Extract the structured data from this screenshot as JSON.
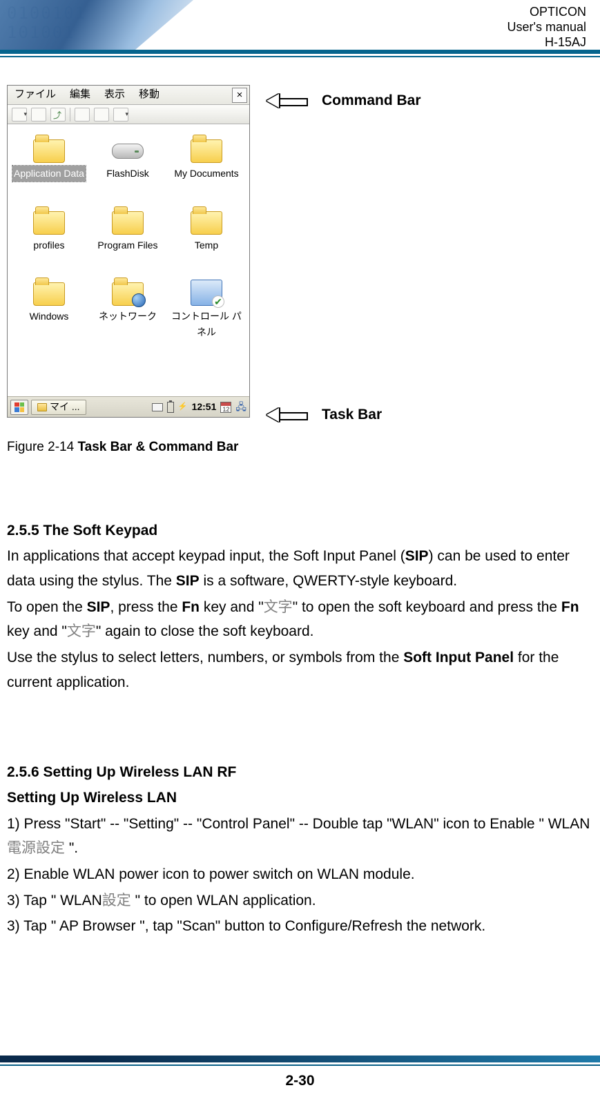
{
  "header": {
    "line1": "OPTICON",
    "line2": "User's manual",
    "line3": "H-15AJ"
  },
  "callouts": {
    "command_bar": "Command Bar",
    "task_bar": "Task Bar"
  },
  "menubar": {
    "file": "ファイル",
    "edit": "編集",
    "view": "表示",
    "go": "移動",
    "close": "×"
  },
  "icons": {
    "app_data": "Application Data",
    "flashdisk": "FlashDisk",
    "my_documents": "My Documents",
    "profiles": "profiles",
    "program_files": "Program Files",
    "temp": "Temp",
    "windows": "Windows",
    "network": "ネットワーク",
    "control_panel_l1": "コントロール パ",
    "control_panel_l2": "ネル"
  },
  "taskbar": {
    "task_label": "マイ ...",
    "clock": "12:51",
    "cal": "12"
  },
  "figure_caption_prefix": "Figure 2-14 ",
  "figure_caption_bold": "Task Bar & Command Bar",
  "section255_title": "2.5.5 The Soft Keypad",
  "section255_p1a": "In applications that accept keypad input, the Soft Input Panel (",
  "section255_p1_sip": "SIP",
  "section255_p1b": ") can be used to enter data using the stylus. The ",
  "section255_p1_sip2": "SIP",
  "section255_p1c": " is a software, QWERTY-style keyboard.",
  "section255_p2a": "To open the ",
  "section255_p2_sip": "SIP",
  "section255_p2b": ", press the ",
  "section255_p2_fn": "Fn",
  "section255_p2c": " key and \"",
  "section255_p2_cjk": "文字",
  "section255_p2d": "\" to open the soft keyboard and press the ",
  "section255_p2_fn2": "Fn",
  "section255_p2e": " key and \"",
  "section255_p2_cjk2": "文字",
  "section255_p2f": "\" again to close the soft keyboard.",
  "section255_p3a": "Use the stylus to select letters, numbers, or symbols from the ",
  "section255_p3_sip": "Soft Input Panel",
  "section255_p3b": " for the current application.",
  "section256_title": "2.5.6 Setting Up Wireless LAN RF",
  "section256_sub": "Setting Up Wireless LAN",
  "section256_l1a": "1) Press \"Start\" -- \"Setting\" -- \"Control Panel\" -- Double tap \"WLAN\" icon to Enable \" WLAN",
  "section256_l1_cjk": "電源設定",
  "section256_l1b": "  \".",
  "section256_l2": "2) Enable WLAN power icon to power switch on WLAN module.",
  "section256_l3a": "3) Tap \" WLAN",
  "section256_l3_cjk": "設定",
  "section256_l3b": "  \" to open WLAN application.",
  "section256_l4": "3) Tap \" AP Browser \", tap \"Scan\" button to Configure/Refresh the network.",
  "page_number": "2-30"
}
